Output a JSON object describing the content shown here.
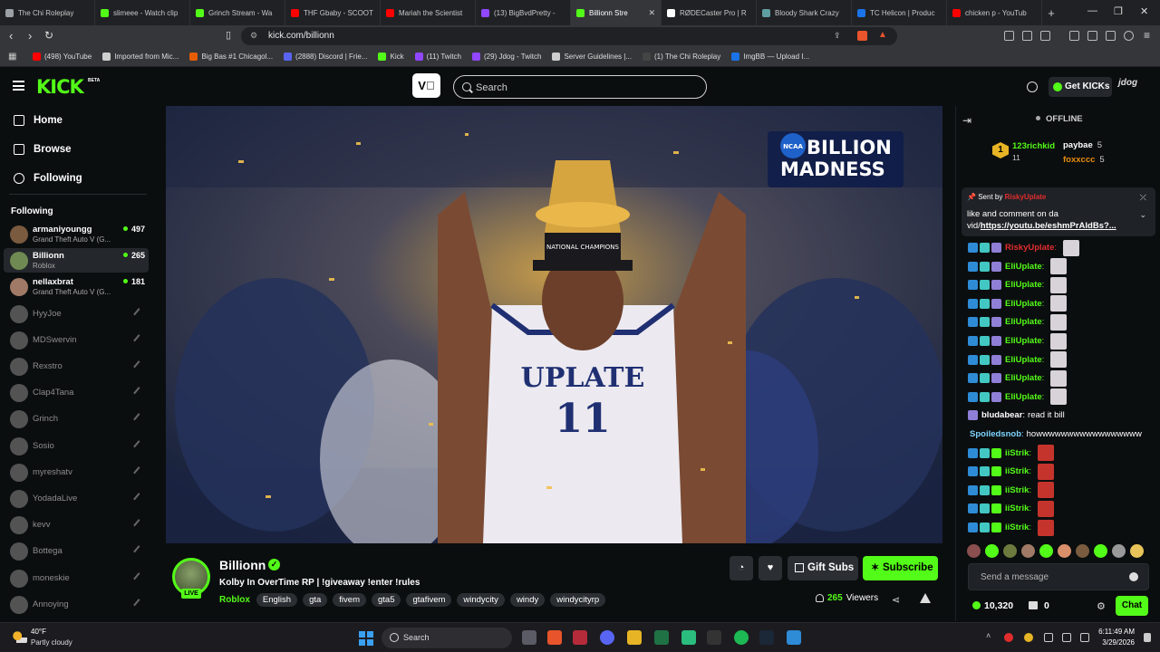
{
  "browser": {
    "tabs": [
      {
        "title": "The Chi Roleplay",
        "color": "#9aa0a6"
      },
      {
        "title": "slimeee - Watch clip",
        "color": "#53fc18"
      },
      {
        "title": "Grinch Stream - Wa",
        "color": "#53fc18"
      },
      {
        "title": "THF Gbaby - SCOOT",
        "color": "#ff0000"
      },
      {
        "title": "Mariah the Scientist",
        "color": "#ff0000"
      },
      {
        "title": "(13) BigBvdPretty -",
        "color": "#9146ff"
      },
      {
        "title": "Billionn Stre",
        "color": "#53fc18",
        "active": true
      },
      {
        "title": "RØDECaster Pro | R",
        "color": "#ffffff"
      },
      {
        "title": "Bloody Shark Crazy",
        "color": "#5f9ea0"
      },
      {
        "title": "TC Helicon | Produc",
        "color": "#1a73e8"
      },
      {
        "title": "chicken p - YouTub",
        "color": "#ff0000"
      }
    ],
    "new_tab": "+",
    "url": "kick.com/billionn",
    "bookmarks": [
      {
        "label": "(498) YouTube",
        "color": "#ff0000"
      },
      {
        "label": "Imported from Mic...",
        "color": "#cfcfcf"
      },
      {
        "label": "Big Bas #1 Chicagol...",
        "color": "#e85d04"
      },
      {
        "label": "(2888) Discord | Frie...",
        "color": "#5865f2"
      },
      {
        "label": "Kick",
        "color": "#53fc18"
      },
      {
        "label": "(11) Twitch",
        "color": "#9146ff"
      },
      {
        "label": "(29) Jdog - Twitch",
        "color": "#9146ff"
      },
      {
        "label": "Server Guidelines |...",
        "color": "#cfcfcf"
      },
      {
        "label": "(1) The Chi Roleplay",
        "color": "#444444"
      },
      {
        "label": "ImgBB — Upload I...",
        "color": "#1a73e8"
      }
    ]
  },
  "kick": {
    "logo": "KICK",
    "logo_badge": "BETA",
    "search_placeholder": "Search",
    "get_kicks_label": "Get KICKs",
    "user_initials": "jdog",
    "nav": [
      {
        "label": "Home",
        "icon": "home-icon"
      },
      {
        "label": "Browse",
        "icon": "browse-icon"
      },
      {
        "label": "Following",
        "icon": "heart-icon"
      }
    ],
    "following_heading": "Following",
    "following": [
      {
        "name": "armaniyoungg",
        "game": "Grand Theft Auto V (G...",
        "viewers": "497",
        "live": true,
        "color": "#7a5b3f"
      },
      {
        "name": "Billionn",
        "game": "Roblox",
        "viewers": "265",
        "live": true,
        "color": "#6f8a52",
        "selected": true
      },
      {
        "name": "nellaxbrat",
        "game": "Grand Theft Auto V (G...",
        "viewers": "181",
        "live": true,
        "color": "#a07a66"
      },
      {
        "name": "HyyJoe",
        "live": false,
        "color": "#8a8a8a"
      },
      {
        "name": "MDSwervin",
        "live": false,
        "color": "#8a8a8a"
      },
      {
        "name": "Rexstro",
        "live": false,
        "color": "#8a8a8a"
      },
      {
        "name": "Clap4Tana",
        "live": false,
        "color": "#8a8a8a"
      },
      {
        "name": "Grinch",
        "live": false,
        "color": "#8a8a8a"
      },
      {
        "name": "Sosio",
        "live": false,
        "color": "#8a8a8a"
      },
      {
        "name": "myreshatv",
        "live": false,
        "color": "#8a8a8a"
      },
      {
        "name": "YodadaLive",
        "live": false,
        "color": "#8a8a8a"
      },
      {
        "name": "kevv",
        "live": false,
        "color": "#8a8a8a"
      },
      {
        "name": "Bottega",
        "live": false,
        "color": "#8a8a8a"
      },
      {
        "name": "moneskie",
        "live": false,
        "color": "#8a8a8a"
      },
      {
        "name": "Annoying",
        "live": false,
        "color": "#8a8a8a"
      }
    ]
  },
  "video": {
    "overlay_line1": "BILLION",
    "overlay_line2": "MADNESS",
    "overlay_badge": "NCAA",
    "jersey_text": "UPLATE",
    "jersey_number": "11",
    "trophy_text": "NATIONAL CHAMPIONS"
  },
  "stream": {
    "channel_name": "Billionn",
    "live_badge": "LIVE",
    "verified_mark": "✓",
    "title": "Kolby In OverTime RP | !giveaway !enter !rules",
    "category": "Roblox",
    "tags": [
      "English",
      "gta",
      "fivem",
      "gta5",
      "gtafivem",
      "windycity",
      "windy",
      "windycityrp"
    ],
    "gift_subs_label": "Gift Subs",
    "subscribe_label": "Subscribe",
    "viewer_count": "265",
    "viewers_label": "Viewers"
  },
  "chat": {
    "status": "OFFLINE",
    "leaderboard": {
      "first": {
        "rank": "1",
        "name": "123richkid",
        "score": "11"
      },
      "second": {
        "name": "paybae",
        "score": "5"
      },
      "third": {
        "name": "foxxccc",
        "score": "5"
      }
    },
    "pinned": {
      "sent_by": "Sent by",
      "user": "RiskyUplate",
      "message": "like and comment on da vid/",
      "link": "https://youtu.be/eshmPrAldBs?..."
    },
    "messages": [
      {
        "user": "RiskyUplate",
        "color": "#e22d2d",
        "text": "",
        "emote": "e-white",
        "badges": [
          "b-blue",
          "b-teal",
          "b-purple"
        ]
      },
      {
        "user": "EliUplate",
        "color": "#53fc18",
        "text": "",
        "emote": "e-white",
        "badges": [
          "b-blue",
          "b-teal",
          "b-purple"
        ]
      },
      {
        "user": "EliUplate",
        "color": "#53fc18",
        "text": "",
        "emote": "e-white",
        "badges": [
          "b-blue",
          "b-teal",
          "b-purple"
        ]
      },
      {
        "user": "EliUplate",
        "color": "#53fc18",
        "text": "",
        "emote": "e-white",
        "badges": [
          "b-blue",
          "b-teal",
          "b-purple"
        ]
      },
      {
        "user": "EliUplate",
        "color": "#53fc18",
        "text": "",
        "emote": "e-white",
        "badges": [
          "b-blue",
          "b-teal",
          "b-purple"
        ]
      },
      {
        "user": "EliUplate",
        "color": "#53fc18",
        "text": "",
        "emote": "e-white",
        "badges": [
          "b-blue",
          "b-teal",
          "b-purple"
        ]
      },
      {
        "user": "EliUplate",
        "color": "#53fc18",
        "text": "",
        "emote": "e-white",
        "badges": [
          "b-blue",
          "b-teal",
          "b-purple"
        ]
      },
      {
        "user": "EliUplate",
        "color": "#53fc18",
        "text": "",
        "emote": "e-white",
        "badges": [
          "b-blue",
          "b-teal",
          "b-purple"
        ]
      },
      {
        "user": "EliUplate",
        "color": "#53fc18",
        "text": "",
        "emote": "e-white",
        "badges": [
          "b-blue",
          "b-teal",
          "b-purple"
        ]
      },
      {
        "user": "bludabear",
        "color": "#ffffff",
        "text": "read it bill",
        "emote": "",
        "badges": [
          "b-purple"
        ]
      },
      {
        "user": "Spoiledsnob",
        "color": "#7fd4ff",
        "text": "howwwwwwwwwwwwwwwww",
        "emote": "",
        "badges": []
      },
      {
        "user": "iiStrik",
        "color": "#53fc18",
        "text": "",
        "emote": "e-red",
        "badges": [
          "b-blue",
          "b-teal",
          "b-green"
        ]
      },
      {
        "user": "iiStrik",
        "color": "#53fc18",
        "text": "",
        "emote": "e-red",
        "badges": [
          "b-blue",
          "b-teal",
          "b-green"
        ]
      },
      {
        "user": "iiStrik",
        "color": "#53fc18",
        "text": "",
        "emote": "e-red",
        "badges": [
          "b-blue",
          "b-teal",
          "b-green"
        ]
      },
      {
        "user": "iiStrik",
        "color": "#53fc18",
        "text": "",
        "emote": "e-red",
        "badges": [
          "b-blue",
          "b-teal",
          "b-green"
        ]
      },
      {
        "user": "iiStrik",
        "color": "#53fc18",
        "text": "",
        "emote": "e-red",
        "badges": [
          "b-blue",
          "b-teal",
          "b-green"
        ]
      }
    ],
    "emote_colors": [
      "#8a4f4f",
      "#53fc18",
      "#6d7a3e",
      "#a07a66",
      "#53fc18",
      "#d98f6a",
      "#7a5b3f",
      "#53fc18",
      "#999999",
      "#e7c35a"
    ],
    "input_placeholder": "Send a message",
    "kicks_balance": "10,320",
    "points_balance": "0",
    "chat_button": "Chat"
  },
  "taskbar": {
    "temperature": "40°F",
    "weather": "Partly cloudy",
    "search_label": "Search",
    "time": "6:11:49 AM",
    "date": "3/29/2026"
  }
}
